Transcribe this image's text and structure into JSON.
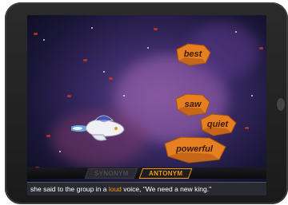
{
  "game": {
    "word_rocks": [
      {
        "id": "best",
        "label": "best"
      },
      {
        "id": "saw",
        "label": "saw"
      },
      {
        "id": "quiet",
        "label": "quiet"
      },
      {
        "id": "powerful",
        "label": "powerful"
      }
    ]
  },
  "mode_tabs": {
    "synonym": "SYNONYM",
    "antonym": "ANTONYM",
    "selected": "antonym"
  },
  "sentence": {
    "before": "she said to the group in a ",
    "target": "loud",
    "after": " voice, \"We need a new king.\""
  },
  "colors": {
    "accent": "#f39c12",
    "rock": "#e67e22",
    "background": "#2a1f4a"
  }
}
